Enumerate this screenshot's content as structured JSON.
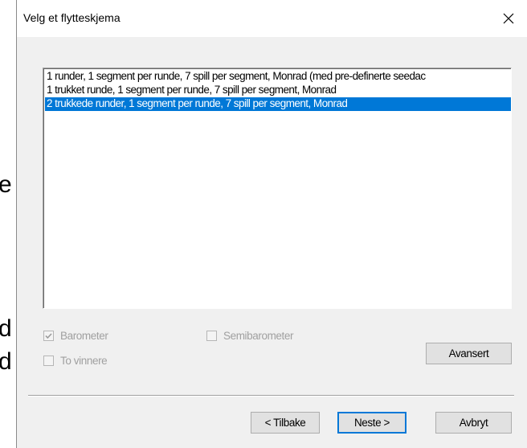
{
  "background": {
    "letters": [
      "e",
      "d",
      "d"
    ]
  },
  "dialog": {
    "title": "Velg et flytteskjema",
    "close_glyph": "✕"
  },
  "schemes": {
    "items": [
      "1 runder, 1 segment per runde, 7 spill per segment, Monrad (med pre-definerte seedac",
      "1 trukket runde, 1 segment per runde, 7 spill per segment, Monrad",
      "2 trukkede runder, 1 segment per runde, 7 spill per segment, Monrad"
    ],
    "selected_index": 2
  },
  "options": {
    "barometer": {
      "label": "Barometer",
      "checked": true,
      "enabled": false
    },
    "semibarometer": {
      "label": "Semibarometer",
      "checked": false,
      "enabled": false
    },
    "to_vinnere": {
      "label": "To vinnere",
      "checked": false,
      "enabled": false
    }
  },
  "buttons": {
    "advanced": "Avansert",
    "back": "< Tilbake",
    "next": "Neste >",
    "cancel": "Avbryt"
  },
  "colors": {
    "selection": "#0078d7",
    "disabled_text": "#a0a0a0",
    "dialog_bg": "#f0f0f0"
  }
}
